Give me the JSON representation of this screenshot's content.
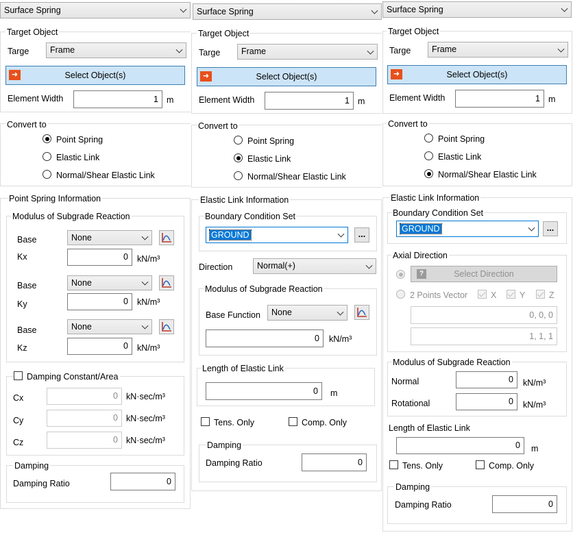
{
  "p1": {
    "header": "Surface Spring",
    "target_legend": "Target Object",
    "target_label": "Targe",
    "target_value": "Frame",
    "select_button": "Select Object(s)",
    "element_width_label": "Element Width",
    "element_width_value": "1",
    "element_width_unit": "m",
    "convert_legend": "Convert to",
    "opt_point": "Point Spring",
    "opt_elastic": "Elastic Link",
    "opt_normal_shear": "Normal/Shear Elastic Link",
    "info_legend": "Point Spring Information",
    "modulus_legend": "Modulus of Subgrade Reaction",
    "base_label": "Base",
    "base_x": "None",
    "base_y": "None",
    "base_z": "None",
    "kx_label": "Kx",
    "ky_label": "Ky",
    "kz_label": "Kz",
    "kx_value": "0",
    "ky_value": "0",
    "kz_value": "0",
    "k_unit": "kN/m³",
    "damping_const_label": "Damping Constant/Area",
    "cx_label": "Cx",
    "cy_label": "Cy",
    "cz_label": "Cz",
    "cx_value": "0",
    "cy_value": "0",
    "cz_value": "0",
    "c_unit": "kN·sec/m³",
    "damping_legend": "Damping",
    "damping_ratio_label": "Damping Ratio",
    "damping_ratio_value": "0"
  },
  "p2": {
    "header": "Surface Spring",
    "target_legend": "Target Object",
    "target_label": "Targe",
    "target_value": "Frame",
    "select_button": "Select Object(s)",
    "element_width_label": "Element Width",
    "element_width_value": "1",
    "element_width_unit": "m",
    "convert_legend": "Convert to",
    "opt_point": "Point Spring",
    "opt_elastic": "Elastic Link",
    "opt_normal_shear": "Normal/Shear Elastic Link",
    "info_legend": "Elastic Link Information",
    "bcs_legend": "Boundary Condition Set",
    "bcs_value": "GROUND",
    "more_button": "...",
    "direction_label": "Direction",
    "direction_value": "Normal(+)",
    "modulus_legend": "Modulus of Subgrade Reaction",
    "base_function_label": "Base Function",
    "base_function_value": "None",
    "modulus_value": "0",
    "modulus_unit": "kN/m³",
    "length_legend": "Length of Elastic Link",
    "length_value": "0",
    "length_unit": "m",
    "tens_only": "Tens. Only",
    "comp_only": "Comp. Only",
    "damping_legend": "Damping",
    "damping_ratio_label": "Damping Ratio",
    "damping_ratio_value": "0"
  },
  "p3": {
    "header": "Surface Spring",
    "target_legend": "Target Object",
    "target_label": "Targe",
    "target_value": "Frame",
    "select_button": "Select Object(s)",
    "element_width_label": "Element Width",
    "element_width_value": "1",
    "element_width_unit": "m",
    "convert_legend": "Convert to",
    "opt_point": "Point Spring",
    "opt_elastic": "Elastic Link",
    "opt_normal_shear": "Normal/Shear Elastic Link",
    "info_legend": "Elastic Link Information",
    "bcs_legend": "Boundary Condition Set",
    "bcs_value": "GROUND",
    "more_button": "...",
    "axial_legend": "Axial Direction",
    "select_direction": "Select Direction",
    "two_points": "2 Points Vector",
    "chk_x": "X",
    "chk_y": "Y",
    "chk_z": "Z",
    "vector1": "0, 0, 0",
    "vector2": "1, 1, 1",
    "modulus_legend": "Modulus of Subgrade Reaction",
    "normal_label": "Normal",
    "normal_value": "0",
    "rotational_label": "Rotational",
    "rotational_value": "0",
    "modulus_unit": "kN/m³",
    "length_legend": "Length of Elastic Link",
    "length_value": "0",
    "length_unit": "m",
    "tens_only": "Tens. Only",
    "comp_only": "Comp. Only",
    "damping_legend": "Damping",
    "damping_ratio_label": "Damping Ratio",
    "damping_ratio_value": "0"
  }
}
